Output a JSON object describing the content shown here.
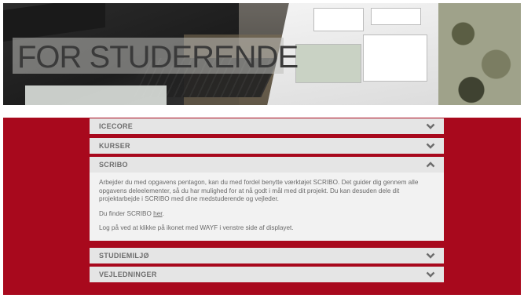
{
  "hero": {
    "title": "FOR STUDERENDE"
  },
  "accordion": [
    {
      "label": "ICECORE",
      "expanded": false
    },
    {
      "label": "KURSER",
      "expanded": false
    },
    {
      "label": "SCRIBO",
      "expanded": true,
      "body": {
        "paragraph1": "Arbejder du med opgavens pentagon, kan du med fordel benytte værktøjet SCRIBO. Det guider dig gennem alle opgavens deleelementer, så du har mulighed for at nå godt i mål med dit projekt. Du kan desuden dele dit projektarbejde i SCRIBO med dine medstuderende og vejleder.",
        "paragraph2_prefix": "Du finder SCRIBO ",
        "paragraph2_link": "her",
        "paragraph2_suffix": ".",
        "paragraph3": "Log på ved at klikke på ikonet med WAYF i venstre side af displayet."
      }
    },
    {
      "label": "STUDIEMILJØ",
      "expanded": false
    },
    {
      "label": "VEJLEDNINGER",
      "expanded": false
    }
  ],
  "colors": {
    "brand_red": "#a8091d",
    "header_bg": "#e5e5e5",
    "body_bg": "#f2f2f2",
    "text": "#6a6a6a"
  },
  "icons": {
    "collapsed": "chevron-down-icon",
    "expanded": "chevron-up-icon"
  }
}
